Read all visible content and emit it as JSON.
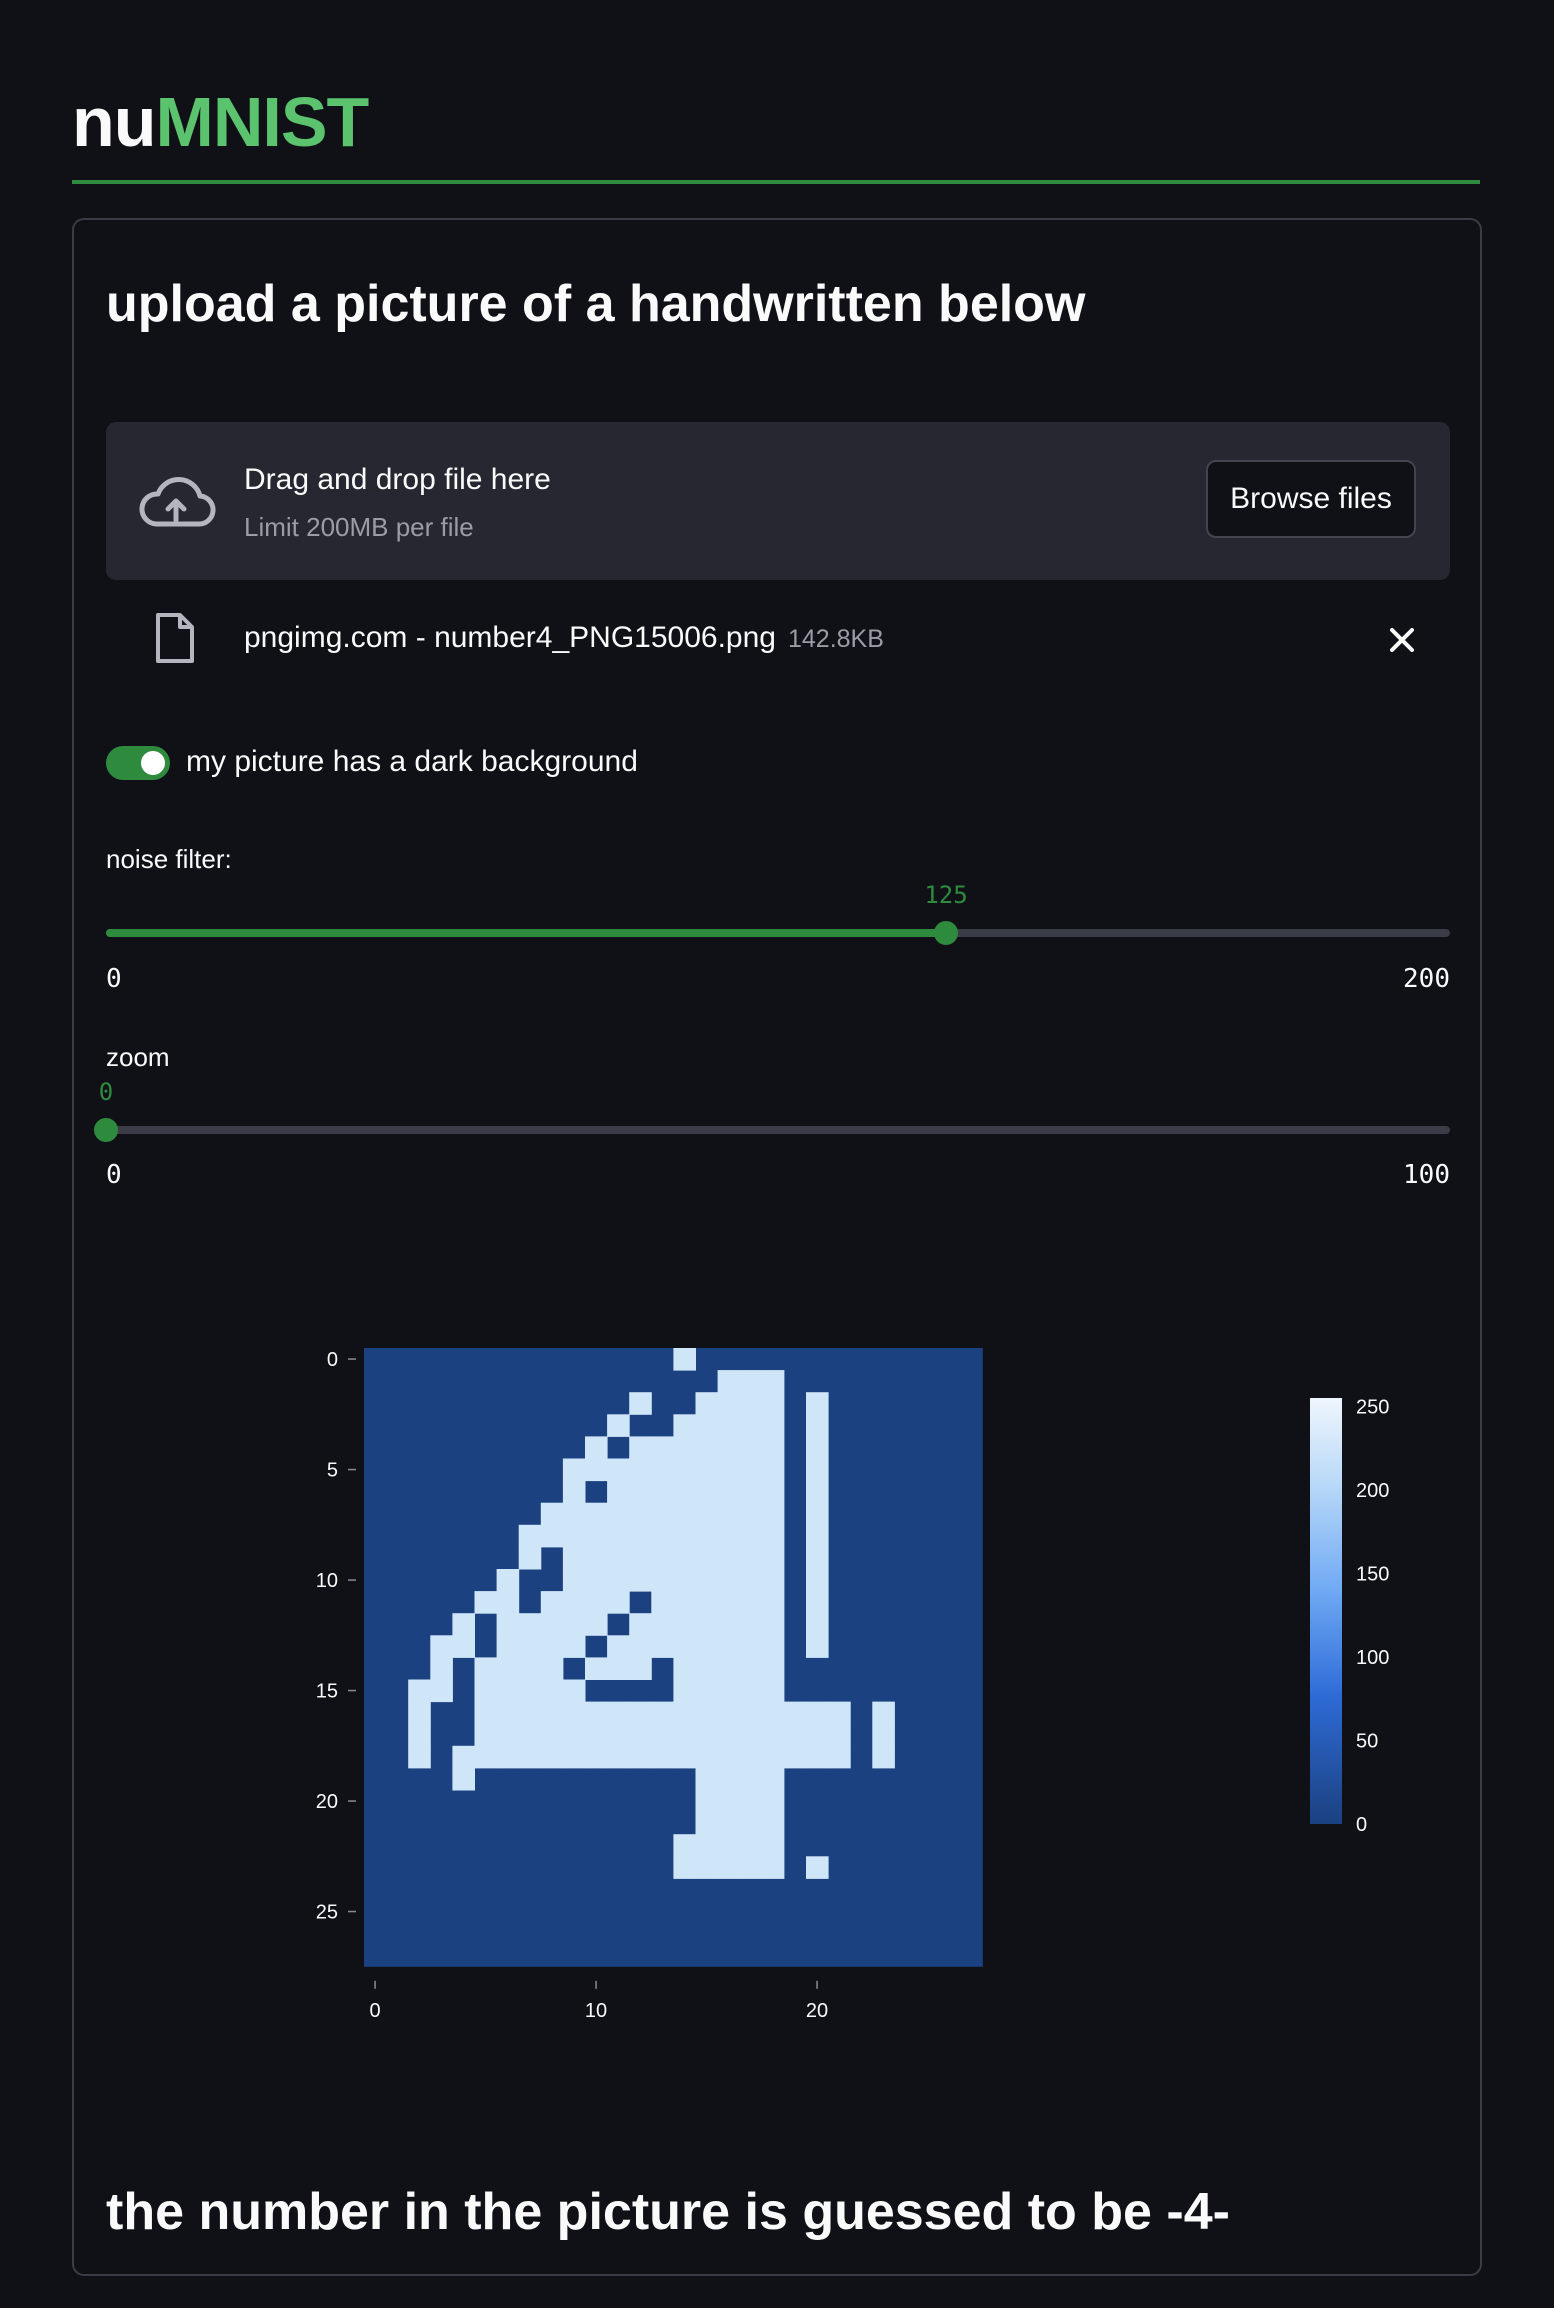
{
  "app": {
    "title_prefix": "nu",
    "title_brand": "MNIST",
    "accent_color": "#2e8b3e"
  },
  "main": {
    "heading": "upload a picture of a handwritten below"
  },
  "uploader": {
    "drop_title": "Drag and drop file here",
    "drop_subtitle": "Limit 200MB per file",
    "browse_label": "Browse files",
    "icon": "cloud-upload-icon"
  },
  "file": {
    "name": "pngimg.com - number4_PNG15006.png",
    "size": "142.8KB",
    "icon": "file-icon",
    "remove_icon": "close-icon"
  },
  "toggle": {
    "label": "my picture has a dark background",
    "checked": true
  },
  "noise_slider": {
    "label": "noise filter:",
    "value": 125,
    "value_text": "125",
    "min_text": "0",
    "max_text": "200",
    "min": 0,
    "max": 200
  },
  "zoom_slider": {
    "label": "zoom",
    "value": 0,
    "value_text": "0",
    "min_text": "0",
    "max_text": "100",
    "min": 0,
    "max": 100
  },
  "chart_data": {
    "type": "heatmap",
    "xlim": [
      0,
      27
    ],
    "ylim": [
      0,
      27
    ],
    "x_ticks": [
      "0",
      "10",
      "20"
    ],
    "y_ticks": [
      "0",
      "5",
      "10",
      "15",
      "20",
      "25"
    ],
    "colorbar": {
      "ticks": [
        "0",
        "50",
        "100",
        "150",
        "200",
        "250"
      ],
      "range": [
        0,
        255
      ],
      "colorscale": "blues"
    },
    "z_high": [
      {
        "row": 0,
        "cols": [
          14
        ]
      },
      {
        "row": 1,
        "cols": [
          16,
          17,
          18
        ]
      },
      {
        "row": 2,
        "cols": [
          12,
          15,
          16,
          17,
          18,
          20
        ]
      },
      {
        "row": 3,
        "cols": [
          11,
          14,
          15,
          16,
          17,
          18,
          20
        ]
      },
      {
        "row": 4,
        "cols": [
          10,
          12,
          13,
          14,
          15,
          16,
          17,
          18,
          20
        ]
      },
      {
        "row": 5,
        "cols": [
          9,
          10,
          11,
          12,
          13,
          14,
          15,
          16,
          17,
          18,
          20
        ]
      },
      {
        "row": 6,
        "cols": [
          9,
          11,
          12,
          13,
          14,
          15,
          16,
          17,
          18,
          20
        ]
      },
      {
        "row": 7,
        "cols": [
          8,
          9,
          10,
          11,
          12,
          13,
          14,
          15,
          16,
          17,
          18,
          20
        ]
      },
      {
        "row": 8,
        "cols": [
          7,
          8,
          9,
          10,
          11,
          12,
          13,
          14,
          15,
          16,
          17,
          18,
          20
        ]
      },
      {
        "row": 9,
        "cols": [
          7,
          9,
          10,
          11,
          12,
          13,
          14,
          15,
          16,
          17,
          18,
          20
        ]
      },
      {
        "row": 10,
        "cols": [
          6,
          9,
          10,
          11,
          12,
          13,
          14,
          15,
          16,
          17,
          18,
          20
        ]
      },
      {
        "row": 11,
        "cols": [
          5,
          6,
          8,
          9,
          10,
          11,
          13,
          14,
          15,
          16,
          17,
          18,
          20
        ]
      },
      {
        "row": 12,
        "cols": [
          4,
          6,
          7,
          8,
          9,
          10,
          12,
          13,
          14,
          15,
          16,
          17,
          18,
          20
        ]
      },
      {
        "row": 13,
        "cols": [
          3,
          4,
          6,
          7,
          8,
          9,
          11,
          12,
          13,
          14,
          15,
          16,
          17,
          18,
          20
        ]
      },
      {
        "row": 14,
        "cols": [
          3,
          5,
          6,
          7,
          8,
          10,
          11,
          12,
          14,
          15,
          16,
          17,
          18
        ]
      },
      {
        "row": 15,
        "cols": [
          2,
          3,
          5,
          6,
          7,
          8,
          9,
          14,
          15,
          16,
          17,
          18
        ]
      },
      {
        "row": 16,
        "cols": [
          2,
          5,
          6,
          7,
          8,
          9,
          10,
          11,
          12,
          13,
          14,
          15,
          16,
          17,
          18,
          19,
          20,
          21,
          23
        ]
      },
      {
        "row": 17,
        "cols": [
          2,
          5,
          6,
          7,
          8,
          9,
          10,
          11,
          12,
          13,
          14,
          15,
          16,
          17,
          18,
          19,
          20,
          21,
          23
        ]
      },
      {
        "row": 18,
        "cols": [
          2,
          4,
          5,
          6,
          7,
          8,
          9,
          10,
          11,
          12,
          13,
          14,
          15,
          16,
          17,
          18,
          19,
          20,
          21,
          23
        ]
      },
      {
        "row": 19,
        "cols": [
          4,
          15,
          16,
          17,
          18
        ]
      },
      {
        "row": 20,
        "cols": [
          15,
          16,
          17,
          18
        ]
      },
      {
        "row": 21,
        "cols": [
          15,
          16,
          17,
          18
        ]
      },
      {
        "row": 22,
        "cols": [
          14,
          15,
          16,
          17,
          18
        ]
      },
      {
        "row": 23,
        "cols": [
          14,
          15,
          16,
          17,
          18,
          20
        ]
      }
    ]
  },
  "result": {
    "text": "the number in the picture is guessed to be -4-"
  }
}
